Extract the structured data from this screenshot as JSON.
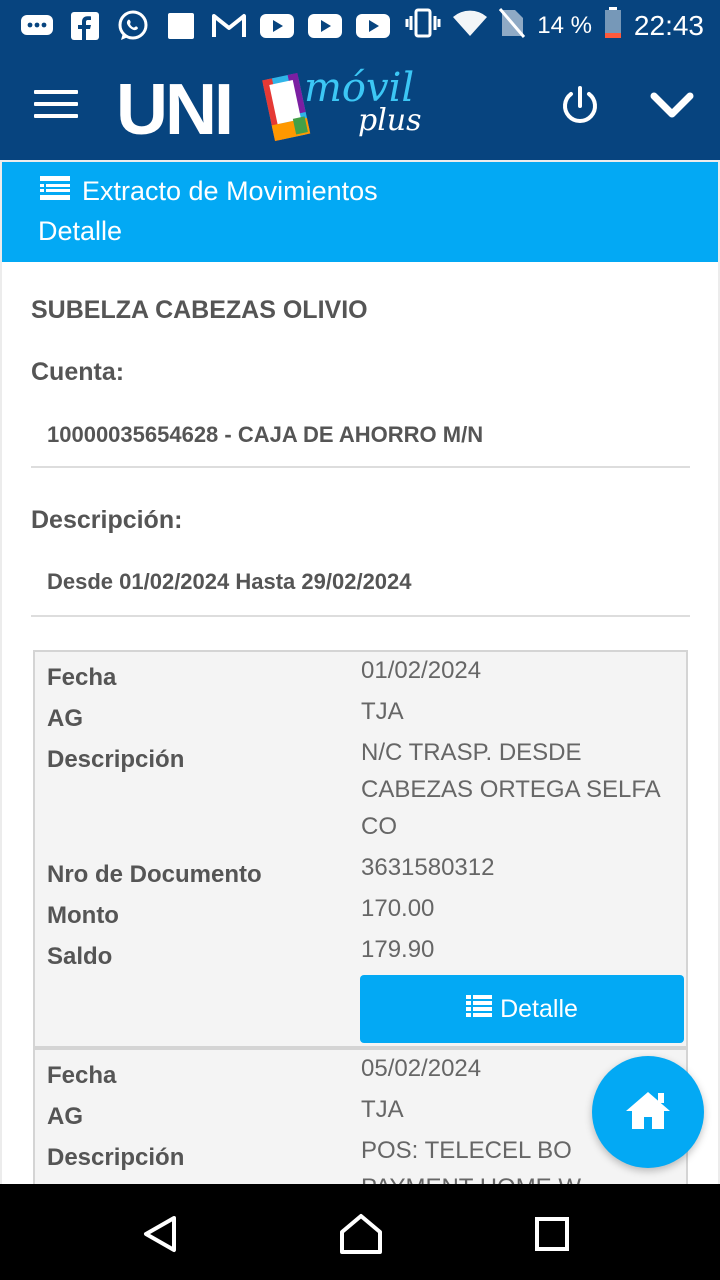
{
  "status_bar": {
    "battery": "14 %",
    "time": "22:43",
    "icons": [
      "messages-icon",
      "facebook-icon",
      "whatsapp-icon",
      "notification-icon",
      "gmail-icon",
      "youtube-icon",
      "youtube-icon",
      "youtube-icon",
      "vibrate-icon",
      "wifi-icon",
      "no-sim-icon",
      "battery-icon"
    ]
  },
  "header": {
    "logo_main": "UNI",
    "logo_sub": "móvil",
    "logo_plus": "plus",
    "brand_colors": {
      "primary": "#07447f",
      "accent": "#03a9f4",
      "logo_movil": "#3cc7f5"
    }
  },
  "page": {
    "title": "Extracto de Movimientos",
    "subtitle": "Detalle"
  },
  "account": {
    "holder": "SUBELZA CABEZAS OLIVIO",
    "cuenta_label": "Cuenta:",
    "cuenta_value": "10000035654628 - CAJA DE AHORRO M/N",
    "descripcion_label": "Descripción:",
    "descripcion_value": "Desde 01/02/2024 Hasta 29/02/2024"
  },
  "labels": {
    "fecha": "Fecha",
    "ag": "AG",
    "descripcion": "Descripción",
    "nro_documento": "Nro de Documento",
    "monto": "Monto",
    "saldo": "Saldo",
    "detalle_button": "Detalle"
  },
  "movements": [
    {
      "fecha": "01/02/2024",
      "ag": "TJA",
      "descripcion": "N/C TRASP. DESDE CABEZAS ORTEGA SELFA CO",
      "nro_documento": "3631580312",
      "monto": "170.00",
      "saldo": "179.90"
    },
    {
      "fecha": "05/02/2024",
      "ag": "TJA",
      "descripcion": "POS: TELECEL BO PAYMENT HOME W"
    }
  ]
}
